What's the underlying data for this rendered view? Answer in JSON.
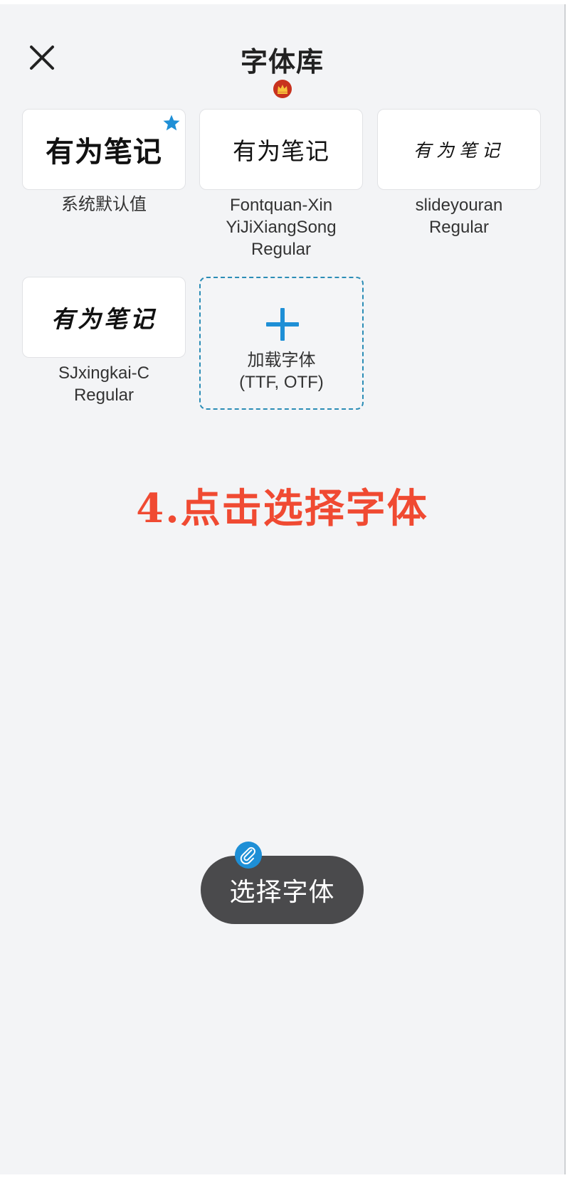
{
  "header": {
    "title": "字体库",
    "close_icon": "close-icon",
    "vip_icon": "crown-badge-icon"
  },
  "fonts": [
    {
      "sample": "有为笔记",
      "label_lines": [
        "系统默认值"
      ],
      "selected": true,
      "selected_icon": "star-icon"
    },
    {
      "sample": "有为笔记",
      "label_lines": [
        "Fontquan-Xin",
        "YiJiXiangSong",
        "Regular"
      ]
    },
    {
      "sample": "有为笔记",
      "label_lines": [
        "slideyouran",
        "Regular"
      ]
    },
    {
      "sample": "有为笔记",
      "label_lines": [
        "SJxingkai-C",
        "Regular"
      ]
    }
  ],
  "add_font": {
    "icon": "plus-icon",
    "label_lines": [
      "加载字体",
      "(TTF, OTF)"
    ]
  },
  "annotation": "4.点击选择字体",
  "select_button": {
    "label": "选择字体",
    "badge_icon": "paperclip-icon"
  },
  "colors": {
    "background": "#f3f4f6",
    "accent": "#1e8fd6",
    "dashed_border": "#2b8db6",
    "annotation": "#f04a32",
    "button": "#4a4a4c",
    "crown_badge": "#c8321e"
  }
}
